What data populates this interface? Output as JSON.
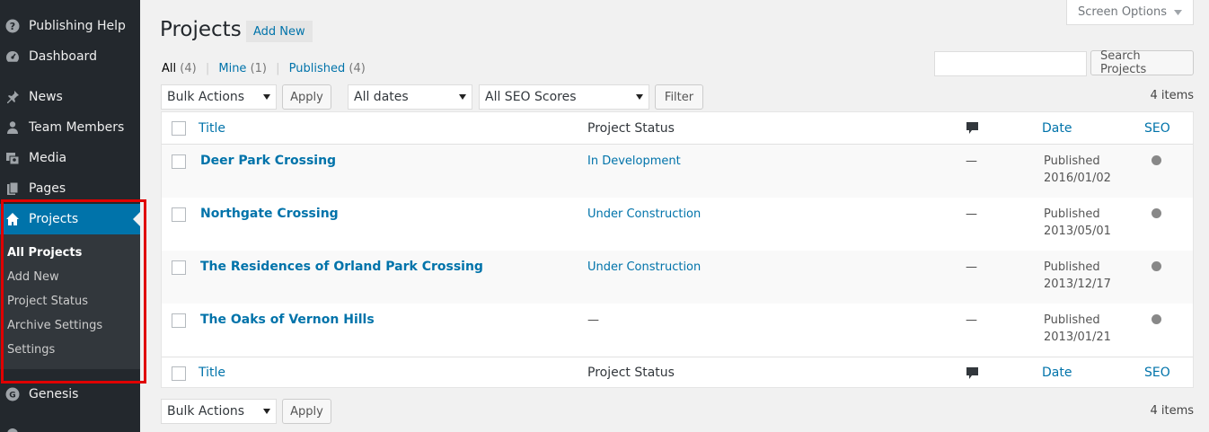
{
  "sidebar": {
    "items": [
      {
        "label": "Publishing Help",
        "icon": "help-icon"
      },
      {
        "label": "Dashboard",
        "icon": "dashboard-icon"
      },
      {
        "label": "News",
        "icon": "pin-icon"
      },
      {
        "label": "Team Members",
        "icon": "users-icon"
      },
      {
        "label": "Media",
        "icon": "media-icon"
      },
      {
        "label": "Pages",
        "icon": "pages-icon"
      },
      {
        "label": "Projects",
        "icon": "home-icon"
      },
      {
        "label": "Genesis",
        "icon": "genesis-icon"
      }
    ],
    "submenu": [
      "All Projects",
      "Add New",
      "Project Status",
      "Archive Settings",
      "Settings"
    ]
  },
  "header": {
    "screen_options": "Screen Options",
    "title": "Projects",
    "add_new": "Add New"
  },
  "filters": {
    "all": "All",
    "all_count": "(4)",
    "mine": "Mine",
    "mine_count": "(1)",
    "published": "Published",
    "published_count": "(4)",
    "bulk_actions": "Bulk Actions",
    "apply": "Apply",
    "all_dates": "All dates",
    "seo_scores": "All SEO Scores",
    "filter": "Filter",
    "search_button": "Search Projects",
    "search_value": "",
    "items_count": "4 items"
  },
  "table": {
    "columns": {
      "title": "Title",
      "status": "Project Status",
      "date": "Date",
      "seo": "SEO"
    },
    "rows": [
      {
        "title": "Deer Park Crossing",
        "status": "In Development",
        "comments": "—",
        "date_status": "Published",
        "date": "2016/01/02"
      },
      {
        "title": "Northgate Crossing",
        "status": "Under Construction",
        "comments": "—",
        "date_status": "Published",
        "date": "2013/05/01"
      },
      {
        "title": "The Residences of Orland Park Crossing",
        "status": "Under Construction",
        "comments": "—",
        "date_status": "Published",
        "date": "2013/12/17"
      },
      {
        "title": "The Oaks of Vernon Hills",
        "status": "—",
        "comments": "—",
        "date_status": "Published",
        "date": "2013/01/21"
      }
    ]
  },
  "colors": {
    "accent": "#0073aa",
    "sidebar_bg": "#23282d",
    "highlight": "#e00000"
  }
}
